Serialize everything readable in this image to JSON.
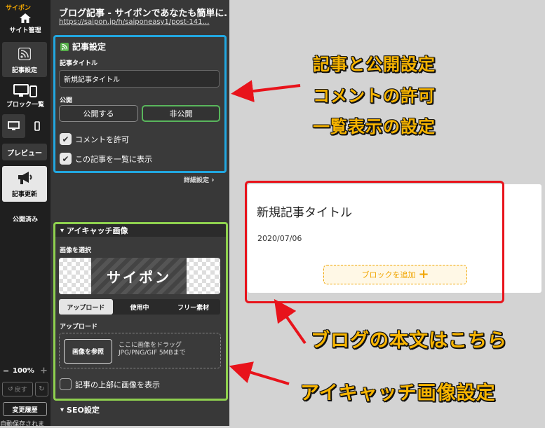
{
  "toolbar": {
    "logo": "サイポン",
    "site_manage": "サイト管理",
    "article_settings": "記事設定",
    "block_list": "ブロック一覧",
    "preview": "プレビュー",
    "update": "記事更新",
    "published": "公開済み",
    "zoom": "100%",
    "undo": "戻す",
    "history": "変更履歴",
    "autosave": "自動保存されま"
  },
  "page": {
    "title": "ブログ記事 - サイポンであなたも簡単に…",
    "url": "https://saipon.jp/h/saiponeasy1/post-141…"
  },
  "article": {
    "section_title": "記事設定",
    "title_label": "記事タイトル",
    "title_value": "新規記事タイトル",
    "publish_label": "公開",
    "publish_btn": "公開する",
    "unpublish_btn": "非公開",
    "allow_comments": "コメントを許可",
    "show_in_list": "この記事を一覧に表示",
    "detail_link": "詳細設定"
  },
  "eyecatch": {
    "section_title": "アイキャッチ画像",
    "select_label": "画像を選択",
    "image_text": "サイポン",
    "tabs": [
      "アップロード",
      "使用中",
      "フリー素材"
    ],
    "upload_label": "アップロード",
    "browse_btn": "画像を参照",
    "drop_line1": "ここに画像をドラッグ",
    "drop_line2": "JPG/PNG/GIF 5MBまで",
    "top_image_check": "記事の上部に画像を表示"
  },
  "seo": {
    "section_title": "SEO設定"
  },
  "blog": {
    "title": "新規記事タイトル",
    "date": "2020/07/06",
    "add_block": "ブロックを追加"
  },
  "annotations": {
    "line1": "記事と公開設定",
    "line2": "コメントの許可",
    "line3": "一覧表示の設定",
    "blog_body": "ブログの本文はこちら",
    "eyecatch_setting": "アイキャッチ画像設定"
  },
  "colors": {
    "blue_frame": "#22a7e0",
    "green_frame": "#8fd14f",
    "red_frame": "#e8131b",
    "accent": "#f0a500"
  }
}
